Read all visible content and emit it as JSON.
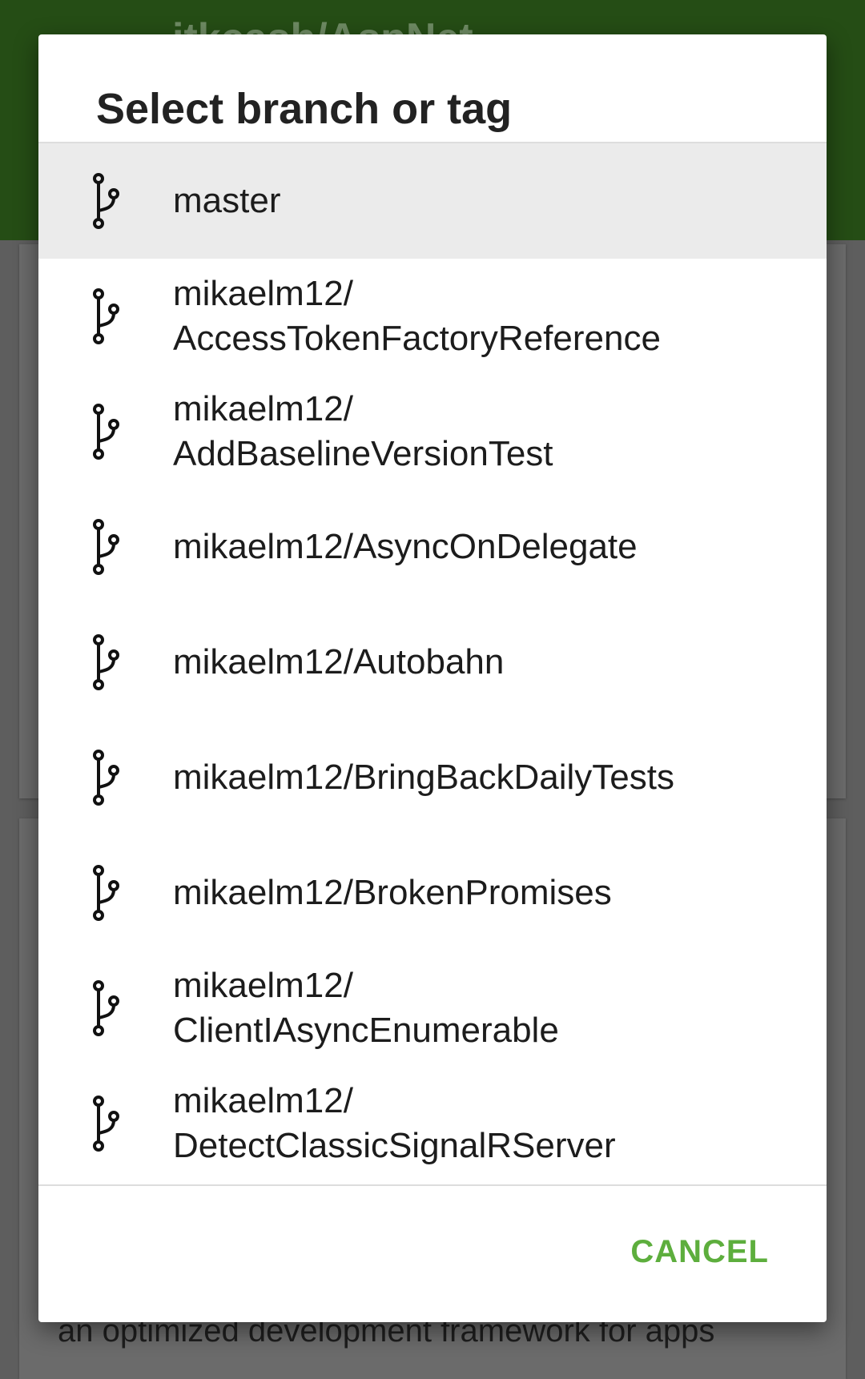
{
  "background": {
    "app_title": "itkcash/AspNet",
    "description_text": "an optimized development framework for apps",
    "colors": {
      "app_bar": "#254d15",
      "scrim": "#5e5e5e"
    }
  },
  "dialog": {
    "title": "Select branch or tag",
    "cancel_label": "CANCEL",
    "accent_color": "#5dae3d",
    "items": [
      {
        "lines": [
          "master"
        ],
        "icon": "branch-icon",
        "selected": true
      },
      {
        "lines": [
          "mikaelm12/",
          "AccessTokenFactoryReference"
        ],
        "icon": "branch-icon",
        "selected": false
      },
      {
        "lines": [
          "mikaelm12/",
          "AddBaselineVersionTest"
        ],
        "icon": "branch-icon",
        "selected": false
      },
      {
        "lines": [
          "mikaelm12/AsyncOnDelegate"
        ],
        "icon": "branch-icon",
        "selected": false
      },
      {
        "lines": [
          "mikaelm12/Autobahn"
        ],
        "icon": "branch-icon",
        "selected": false
      },
      {
        "lines": [
          "mikaelm12/BringBackDailyTests"
        ],
        "icon": "branch-icon",
        "selected": false
      },
      {
        "lines": [
          "mikaelm12/BrokenPromises"
        ],
        "icon": "branch-icon",
        "selected": false
      },
      {
        "lines": [
          "mikaelm12/",
          "ClientIAsyncEnumerable"
        ],
        "icon": "branch-icon",
        "selected": false
      },
      {
        "lines": [
          "mikaelm12/",
          "DetectClassicSignalRServer"
        ],
        "icon": "branch-icon",
        "selected": false
      }
    ]
  }
}
